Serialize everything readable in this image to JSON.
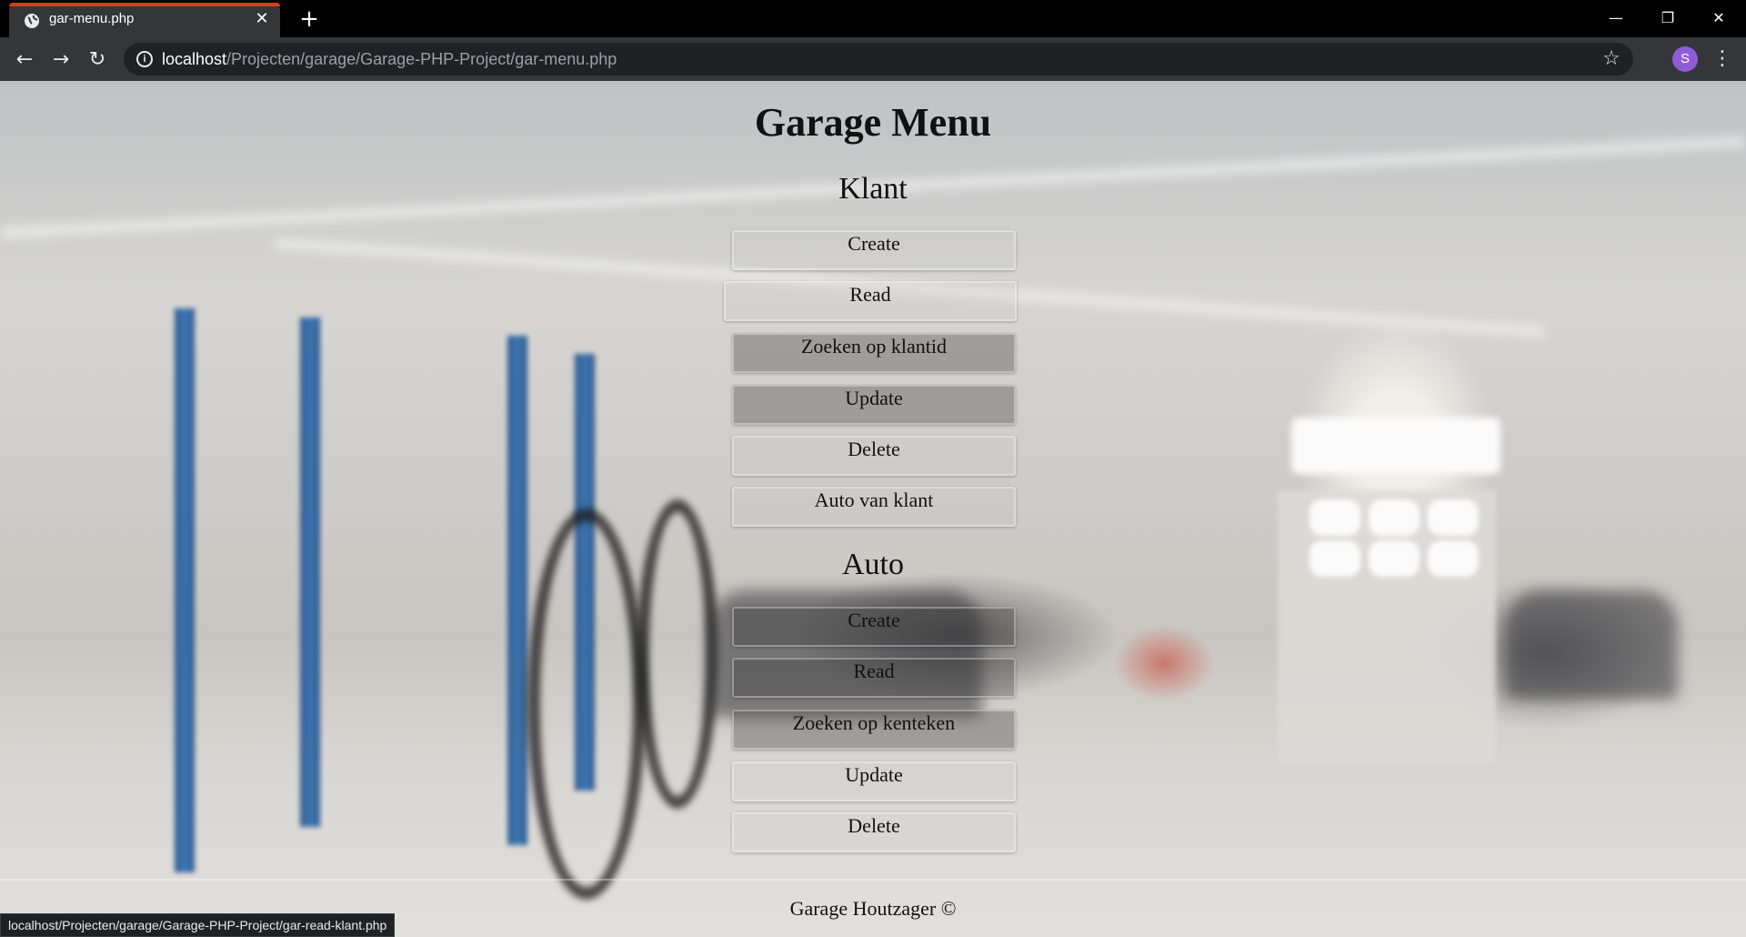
{
  "browser": {
    "tab_title": "gar-menu.php",
    "url_host": "localhost",
    "url_path": "/Projecten/garage/Garage-PHP-Project/gar-menu.php",
    "avatar_initial": "S",
    "status_url": "localhost/Projecten/garage/Garage-PHP-Project/gar-read-klant.php",
    "icons": {
      "back": "arrow-left-icon",
      "forward": "arrow-right-icon",
      "reload": "reload-icon",
      "info": "info-icon",
      "bookmark": "star-icon",
      "menu": "kebab-icon",
      "new_tab": "plus-icon",
      "close_tab": "close-icon"
    },
    "accent_color": "#d83b1f"
  },
  "page": {
    "title": "Garage Menu",
    "sections": [
      {
        "heading": "Klant",
        "buttons": [
          "Create",
          "Read",
          "Zoeken op klantid",
          "Update",
          "Delete",
          "Auto van klant"
        ]
      },
      {
        "heading": "Auto",
        "buttons": [
          "Create",
          "Read",
          "Zoeken op kenteken",
          "Update",
          "Delete"
        ]
      }
    ],
    "footer": "Garage Houtzager ©"
  }
}
